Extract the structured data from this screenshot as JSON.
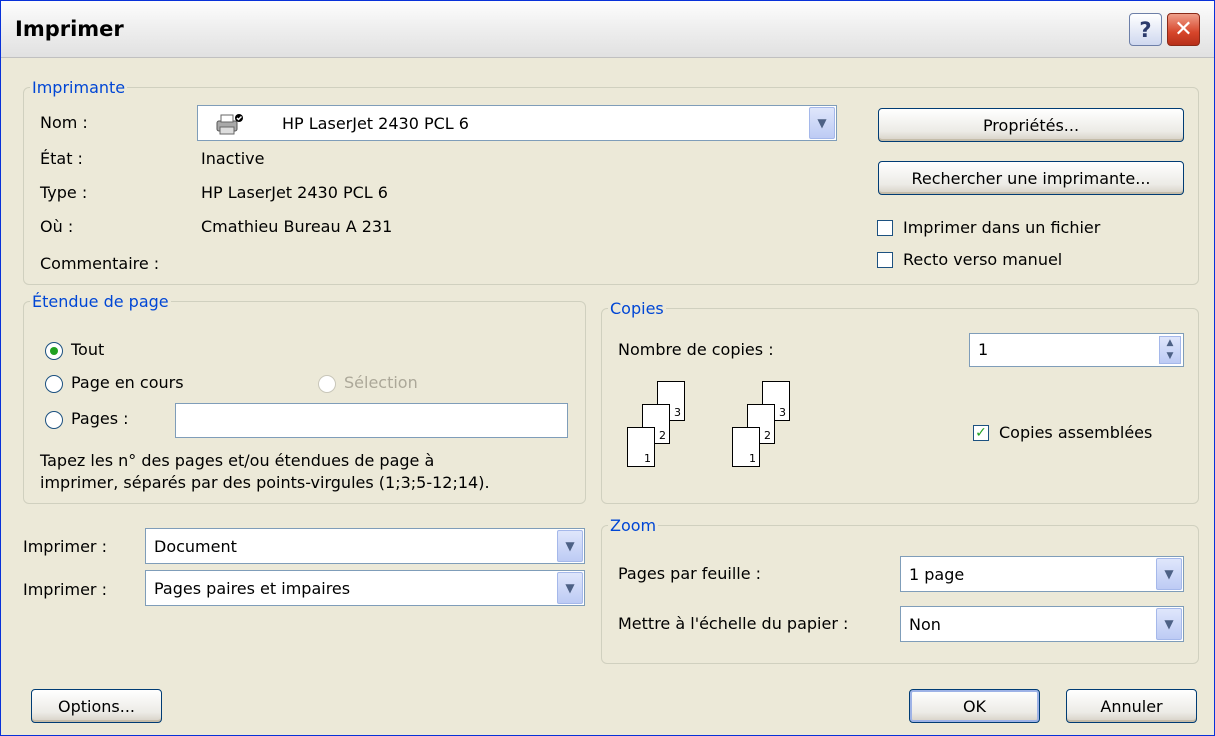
{
  "window": {
    "title": "Imprimer",
    "help_icon": "question-mark",
    "close_icon": "x-close"
  },
  "printer": {
    "legend": "Imprimante",
    "name_label": "Nom :",
    "name_value": "HP LaserJet 2430 PCL 6",
    "printer_icon": "printer-icon",
    "state_label": "État :",
    "state_value": "Inactive",
    "type_label": "Type :",
    "type_value": "HP LaserJet 2430 PCL 6",
    "where_label": "Où :",
    "where_value": "Cmathieu Bureau A 231",
    "comment_label": "Commentaire :",
    "properties_button": "Propriétés...",
    "find_printer_button": "Rechercher une imprimante...",
    "print_to_file_label": "Imprimer dans un fichier",
    "print_to_file_checked": false,
    "manual_duplex_label": "Recto verso manuel",
    "manual_duplex_checked": false
  },
  "page_range": {
    "legend": "Étendue de page",
    "all_label": "Tout",
    "current_page_label": "Page en cours",
    "selection_label": "Sélection",
    "pages_label": "Pages :",
    "pages_value": "",
    "selected": "all",
    "help_line1": "Tapez les n° des pages et/ou étendues de page à",
    "help_line2": "imprimer, séparés par des points-virgules (1;3;5-12;14)."
  },
  "copies": {
    "legend": "Copies",
    "count_label": "Nombre de copies :",
    "count_value": "1",
    "collate_label": "Copies assemblées",
    "collate_checked": true,
    "page_numbers": [
      "1",
      "2",
      "3"
    ]
  },
  "print_what": {
    "label": "Imprimer :",
    "value": "Document"
  },
  "print_pages": {
    "label": "Imprimer :",
    "value": "Pages paires et impaires"
  },
  "zoom": {
    "legend": "Zoom",
    "pages_per_sheet_label": "Pages par feuille :",
    "pages_per_sheet_value": "1 page",
    "scale_label": "Mettre à l'échelle du papier :",
    "scale_value": "Non"
  },
  "footer": {
    "options_button": "Options...",
    "ok_button": "OK",
    "cancel_button": "Annuler"
  },
  "colors": {
    "accent": "#0046d5",
    "face": "#ece9d8",
    "check": "#21a121",
    "close": "#d6452a"
  }
}
